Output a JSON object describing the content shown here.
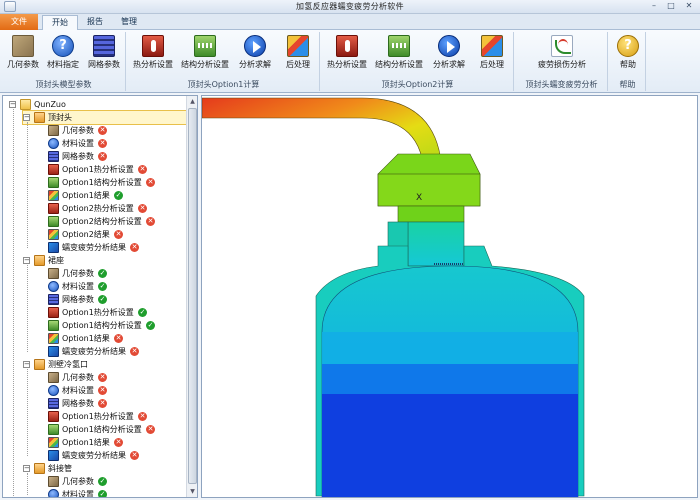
{
  "app": {
    "title": "加氢反应器蠕变疲劳分析软件",
    "window_controls": {
      "minimize": "–",
      "maximize": "□",
      "close": "✕"
    }
  },
  "tabs": [
    {
      "label": "文件"
    },
    {
      "label": "开始"
    },
    {
      "label": "报告"
    },
    {
      "label": "管理"
    }
  ],
  "ribbon": {
    "groups": [
      {
        "label": "顶封头模型参数",
        "buttons": [
          {
            "label": "几何参数",
            "icon": "box-icon"
          },
          {
            "label": "材料指定",
            "icon": "help-icon"
          },
          {
            "label": "网格参数",
            "icon": "grid-icon"
          }
        ]
      },
      {
        "label": "顶封头Option1计算",
        "buttons": [
          {
            "label": "热分析设置",
            "icon": "heat-icon"
          },
          {
            "label": "结构分析设置",
            "icon": "structure-icon"
          },
          {
            "label": "分析求解",
            "icon": "play-icon"
          },
          {
            "label": "后处理",
            "icon": "postprocess-icon"
          }
        ]
      },
      {
        "label": "顶封头Option2计算",
        "buttons": [
          {
            "label": "热分析设置",
            "icon": "heat-icon"
          },
          {
            "label": "结构分析设置",
            "icon": "structure-icon"
          },
          {
            "label": "分析求解",
            "icon": "play-icon"
          },
          {
            "label": "后处理",
            "icon": "postprocess-icon"
          }
        ]
      },
      {
        "label": "顶封头蠕变疲劳分析",
        "buttons": [
          {
            "label": "疲劳损伤分析",
            "icon": "fatigue-icon"
          }
        ]
      },
      {
        "label": "帮助",
        "buttons": [
          {
            "label": "帮助",
            "icon": "help-coin-icon"
          }
        ]
      }
    ]
  },
  "tree": {
    "root": "QunZuo",
    "parts": [
      {
        "label": "顶封头",
        "items": [
          {
            "label": "几何参数",
            "status": "error"
          },
          {
            "label": "材料设置",
            "status": "error"
          },
          {
            "label": "网格参数",
            "status": "error"
          },
          {
            "label": "Option1热分析设置",
            "status": "error"
          },
          {
            "label": "Option1结构分析设置",
            "status": "error"
          },
          {
            "label": "Option1结果",
            "status": "ok"
          },
          {
            "label": "Option2热分析设置",
            "status": "error"
          },
          {
            "label": "Option2结构分析设置",
            "status": "error"
          },
          {
            "label": "Option2结果",
            "status": "error"
          },
          {
            "label": "蠕变疲劳分析结果",
            "status": "error"
          }
        ]
      },
      {
        "label": "裙座",
        "items": [
          {
            "label": "几何参数",
            "status": "ok"
          },
          {
            "label": "材料设置",
            "status": "ok"
          },
          {
            "label": "网格参数",
            "status": "ok"
          },
          {
            "label": "Option1热分析设置",
            "status": "ok"
          },
          {
            "label": "Option1结构分析设置",
            "status": "ok"
          },
          {
            "label": "Option1结果",
            "status": "error"
          },
          {
            "label": "蠕变疲劳分析结果",
            "status": "error"
          }
        ]
      },
      {
        "label": "测壁冷氢口",
        "items": [
          {
            "label": "几何参数",
            "status": "error"
          },
          {
            "label": "材料设置",
            "status": "error"
          },
          {
            "label": "网格参数",
            "status": "error"
          },
          {
            "label": "Option1热分析设置",
            "status": "error"
          },
          {
            "label": "Option1结构分析设置",
            "status": "error"
          },
          {
            "label": "Option1结果",
            "status": "error"
          },
          {
            "label": "蠕变疲劳分析结果",
            "status": "error"
          }
        ]
      },
      {
        "label": "斜接管",
        "items": [
          {
            "label": "几何参数",
            "status": "ok"
          },
          {
            "label": "材料设置",
            "status": "ok"
          }
        ]
      }
    ]
  },
  "viewport": {
    "axis_label": "X",
    "palette": {
      "red": "#e53a1c",
      "orange": "#f08a1a",
      "yellow": "#e5dc14",
      "green": "#7ad61a",
      "cyan": "#19d2a4",
      "teal": "#15c8d6",
      "blue_light": "#12a0e8",
      "blue": "#0f3fe0"
    }
  },
  "status": {
    "ok_glyph": "✓",
    "error_glyph": "✕"
  }
}
